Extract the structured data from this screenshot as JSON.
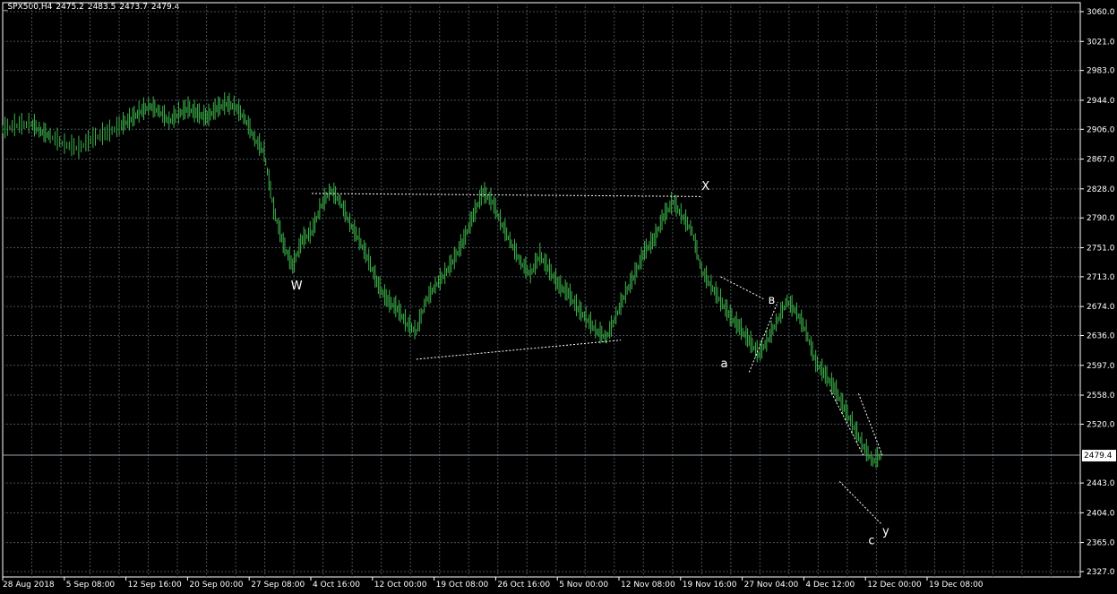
{
  "header": {
    "symbol": "_SPX500,H4",
    "open": "2475.2",
    "high": "2483.5",
    "low": "2473.7",
    "close": "2479.4"
  },
  "current_price_label": "2479.4",
  "colors": {
    "background": "#000000",
    "grid": "#48515a",
    "candle": "#3cb44a",
    "text": "#ffffff",
    "axis": "#ffffff"
  },
  "chart_data": {
    "type": "line",
    "ylim": [
      2327.0,
      3060.0
    ],
    "price_ticks": [
      "3060.0",
      "3021.0",
      "2983.0",
      "2944.0",
      "2906.0",
      "2867.0",
      "2828.0",
      "2790.0",
      "2751.0",
      "2713.0",
      "2674.0",
      "2636.0",
      "2597.0",
      "2558.0",
      "2520.0",
      "2443.0",
      "2404.0",
      "2365.0",
      "2327.0"
    ],
    "time_ticks": [
      "28 Aug 2018",
      "5 Sep 08:00",
      "12 Sep 16:00",
      "20 Sep 00:00",
      "27 Sep 08:00",
      "4 Oct 16:00",
      "12 Oct 00:00",
      "19 Oct 08:00",
      "26 Oct 16:00",
      "5 Nov 00:00",
      "12 Nov 08:00",
      "19 Nov 16:00",
      "27 Nov 04:00",
      "4 Dec 12:00",
      "12 Dec 00:00",
      "19 Dec 08:00"
    ],
    "last_price": 2479.4,
    "series": [
      {
        "key": "price_path",
        "points": [
          [
            0,
            2905
          ],
          [
            3,
            2910
          ],
          [
            6,
            2912
          ],
          [
            8,
            2902
          ],
          [
            10,
            2896
          ],
          [
            13,
            2885
          ],
          [
            16,
            2880
          ],
          [
            19,
            2893
          ],
          [
            22,
            2900
          ],
          [
            25,
            2910
          ],
          [
            27,
            2918
          ],
          [
            29,
            2928
          ],
          [
            31,
            2935
          ],
          [
            33,
            2928
          ],
          [
            35,
            2915
          ],
          [
            37,
            2925
          ],
          [
            39,
            2932
          ],
          [
            41,
            2925
          ],
          [
            43,
            2920
          ],
          [
            45,
            2932
          ],
          [
            47,
            2938
          ],
          [
            49,
            2934
          ],
          [
            51,
            2918
          ],
          [
            53,
            2892
          ],
          [
            55,
            2875
          ],
          [
            57,
            2800
          ],
          [
            59,
            2755
          ],
          [
            61,
            2725
          ],
          [
            63,
            2760
          ],
          [
            65,
            2770
          ],
          [
            67,
            2805
          ],
          [
            69,
            2825
          ],
          [
            71,
            2810
          ],
          [
            73,
            2782
          ],
          [
            75,
            2760
          ],
          [
            77,
            2733
          ],
          [
            79,
            2700
          ],
          [
            81,
            2680
          ],
          [
            83,
            2670
          ],
          [
            85,
            2650
          ],
          [
            87,
            2640
          ],
          [
            89,
            2680
          ],
          [
            91,
            2700
          ],
          [
            93,
            2715
          ],
          [
            95,
            2735
          ],
          [
            97,
            2760
          ],
          [
            99,
            2792
          ],
          [
            101,
            2822
          ],
          [
            103,
            2810
          ],
          [
            105,
            2780
          ],
          [
            107,
            2755
          ],
          [
            109,
            2730
          ],
          [
            111,
            2715
          ],
          [
            113,
            2740
          ],
          [
            115,
            2720
          ],
          [
            117,
            2700
          ],
          [
            119,
            2690
          ],
          [
            121,
            2670
          ],
          [
            123,
            2655
          ],
          [
            125,
            2640
          ],
          [
            127,
            2632
          ],
          [
            129,
            2660
          ],
          [
            131,
            2690
          ],
          [
            133,
            2715
          ],
          [
            135,
            2745
          ],
          [
            137,
            2760
          ],
          [
            139,
            2790
          ],
          [
            141,
            2810
          ],
          [
            143,
            2790
          ],
          [
            145,
            2772
          ],
          [
            147,
            2720
          ],
          [
            149,
            2700
          ],
          [
            151,
            2680
          ],
          [
            153,
            2660
          ],
          [
            155,
            2645
          ],
          [
            157,
            2628
          ],
          [
            159,
            2610
          ],
          [
            161,
            2630
          ],
          [
            163,
            2655
          ],
          [
            165,
            2680
          ],
          [
            167,
            2665
          ],
          [
            169,
            2640
          ],
          [
            171,
            2600
          ],
          [
            173,
            2583
          ],
          [
            175,
            2565
          ],
          [
            177,
            2540
          ],
          [
            179,
            2515
          ],
          [
            181,
            2490
          ],
          [
            183,
            2470
          ],
          [
            185,
            2479.4
          ]
        ]
      }
    ]
  },
  "annotations": {
    "wave_w": "W",
    "wave_x": "X",
    "wave_a": "a",
    "wave_b": "в",
    "wave_c": "c",
    "wave_y": "y"
  }
}
